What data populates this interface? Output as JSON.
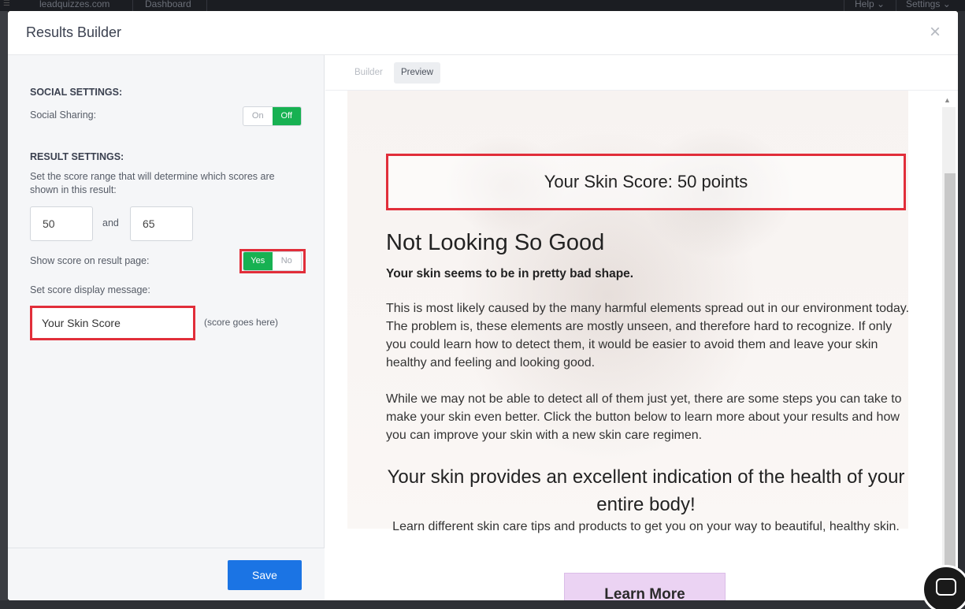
{
  "app_bar": {
    "site": "leadquizzes.com",
    "nav": "Dashboard",
    "help": "Help",
    "settings": "Settings"
  },
  "modal": {
    "title": "Results Builder",
    "close_icon": "×"
  },
  "left": {
    "social_heading": "SOCIAL SETTINGS:",
    "social_sharing_label": "Social Sharing:",
    "social_toggle": {
      "on": "On",
      "off": "Off",
      "selected": "Off"
    },
    "result_heading": "RESULT SETTINGS:",
    "range_description": "Set the score range that will determine which scores are shown in this result:",
    "range_min": "50",
    "range_and": "and",
    "range_max": "65",
    "show_score_label": "Show score on result page:",
    "show_score_toggle": {
      "yes": "Yes",
      "no": "No",
      "selected": "Yes"
    },
    "display_msg_label": "Set score display message:",
    "display_msg_value": "Your Skin Score",
    "score_hint": "(score goes here)",
    "save_label": "Save"
  },
  "right": {
    "tabs": [
      {
        "label": "Builder"
      },
      {
        "label": "Preview",
        "active": true
      }
    ],
    "preview": {
      "score_line": "Your Skin Score: 50 points",
      "title": "Not Looking So Good",
      "subtitle": "Your skin seems to be in pretty bad shape.",
      "paragraph1": "This is most likely caused by the many harmful elements spread out in our environment today. The problem is, these elements are mostly unseen, and therefore hard to recognize. If only you could learn how to detect them, it would be easier to avoid them and leave your skin healthy and feeling and looking good.",
      "paragraph2": "While we may not be able to detect all of them just yet, there are some steps you can take to make your skin even better. Click the button below to learn more about your results and how you can improve your skin with a new skin care regimen.",
      "cta_heading": "Your skin provides an excellent indication of the health of your entire body!",
      "cta_sub": "Learn different skin care tips and products to get you on your way to beautiful, healthy skin.",
      "button_label": "Learn More"
    }
  },
  "colors": {
    "toggle_active": "#17b152",
    "highlight_border": "#e12e3a",
    "save_button": "#1b74e4",
    "learn_more_button": "#ebd3f3"
  }
}
